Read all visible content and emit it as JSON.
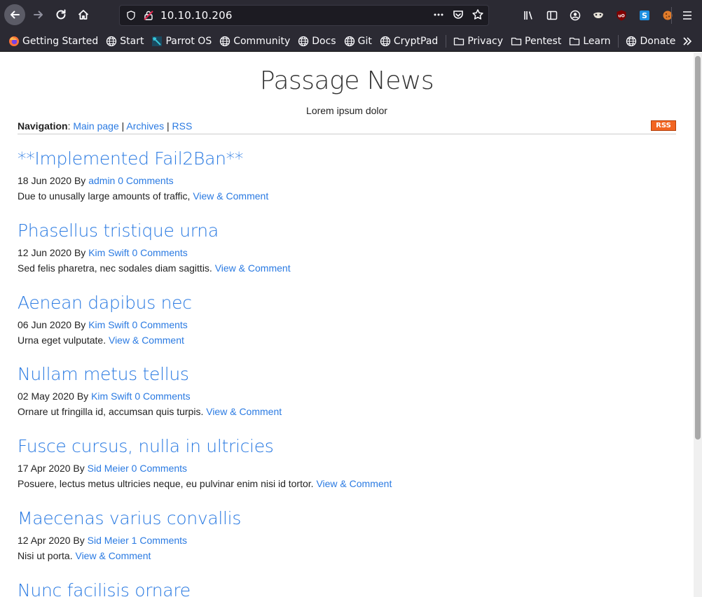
{
  "browser": {
    "url": "10.10.10.206",
    "bookmarks": [
      {
        "label": "Getting Started",
        "icon": "firefox-icon"
      },
      {
        "label": "Start",
        "icon": "globe-icon"
      },
      {
        "label": "Parrot OS",
        "icon": "parrot-icon"
      },
      {
        "label": "Community",
        "icon": "globe-icon"
      },
      {
        "label": "Docs",
        "icon": "globe-icon"
      },
      {
        "label": "Git",
        "icon": "globe-icon"
      },
      {
        "label": "CryptPad",
        "icon": "globe-icon"
      },
      {
        "label": "Privacy",
        "icon": "folder-icon"
      },
      {
        "label": "Pentest",
        "icon": "folder-icon"
      },
      {
        "label": "Learn",
        "icon": "folder-icon"
      },
      {
        "label": "Donate",
        "icon": "globe-icon"
      }
    ]
  },
  "site": {
    "title": "Passage News",
    "subtitle": "Lorem ipsum dolor",
    "nav_label": "Navigation",
    "nav_links": [
      "Main page",
      "Archives",
      "RSS"
    ],
    "rss_badge": "RSS"
  },
  "posts": [
    {
      "title": "**Implemented Fail2Ban**",
      "date": "18 Jun 2020",
      "by": "By",
      "author": "admin",
      "comments": "0 Comments",
      "excerpt": "Due to unusally large amounts of traffic,",
      "link": "View & Comment"
    },
    {
      "title": "Phasellus tristique urna",
      "date": "12 Jun 2020",
      "by": "By",
      "author": "Kim Swift",
      "comments": "0 Comments",
      "excerpt": "Sed felis pharetra, nec sodales diam sagittis.",
      "link": "View & Comment"
    },
    {
      "title": "Aenean dapibus nec",
      "date": "06 Jun 2020",
      "by": "By",
      "author": "Kim Swift",
      "comments": "0 Comments",
      "excerpt": "Urna eget vulputate.",
      "link": "View & Comment"
    },
    {
      "title": "Nullam metus tellus",
      "date": "02 May 2020",
      "by": "By",
      "author": "Kim Swift",
      "comments": "0 Comments",
      "excerpt": "Ornare ut fringilla id, accumsan quis turpis.",
      "link": "View & Comment"
    },
    {
      "title": "Fusce cursus, nulla in ultricies",
      "date": "17 Apr 2020",
      "by": "By",
      "author": "Sid Meier",
      "comments": "0 Comments",
      "excerpt": "Posuere, lectus metus ultricies neque, eu pulvinar enim nisi id tortor.",
      "link": "View & Comment"
    },
    {
      "title": "Maecenas varius convallis",
      "date": "12 Apr 2020",
      "by": "By",
      "author": "Sid Meier",
      "comments": "1 Comments",
      "excerpt": "Nisi ut porta.",
      "link": "View & Comment"
    },
    {
      "title": "Nunc facilisis ornare",
      "date": "",
      "by": "",
      "author": "",
      "comments": "",
      "excerpt": "",
      "link": ""
    }
  ]
}
